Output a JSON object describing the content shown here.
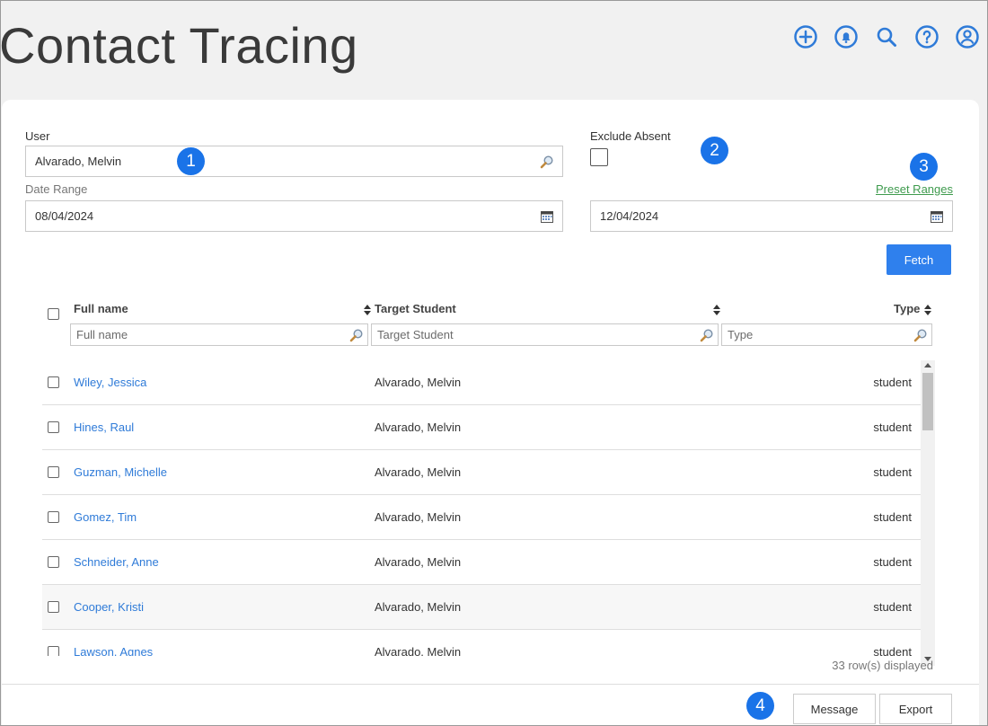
{
  "page": {
    "title": "Contact Tracing"
  },
  "header_icons": [
    "add-circle-icon",
    "bell-icon",
    "search-icon",
    "help-icon",
    "user-account-icon"
  ],
  "colors": {
    "accent": "#2f80ed",
    "badge": "#1a73e8",
    "link": "#2f7bd8",
    "preset_link": "#3f9b4e"
  },
  "form": {
    "user_label": "User",
    "user_value": "Alvarado, Melvin",
    "exclude_absent_label": "Exclude Absent",
    "exclude_absent_checked": false,
    "date_range_label": "Date Range",
    "start_date": "08/04/2024",
    "end_date": "12/04/2024",
    "preset_ranges_label": "Preset Ranges",
    "fetch_label": "Fetch"
  },
  "badges": [
    "1",
    "2",
    "3",
    "4"
  ],
  "grid": {
    "columns": [
      "Full name",
      "Target Student",
      "Type"
    ],
    "filters": {
      "full_name": "Full name",
      "target_student": "Target Student",
      "type": "Type"
    },
    "rows": [
      {
        "full_name": "Wiley, Jessica",
        "target": "Alvarado, Melvin",
        "type": "student"
      },
      {
        "full_name": "Hines, Raul",
        "target": "Alvarado, Melvin",
        "type": "student"
      },
      {
        "full_name": "Guzman, Michelle",
        "target": "Alvarado, Melvin",
        "type": "student"
      },
      {
        "full_name": "Gomez, Tim",
        "target": "Alvarado, Melvin",
        "type": "student"
      },
      {
        "full_name": "Schneider, Anne",
        "target": "Alvarado, Melvin",
        "type": "student"
      },
      {
        "full_name": "Cooper, Kristi",
        "target": "Alvarado, Melvin",
        "type": "student"
      },
      {
        "full_name": "Lawson, Agnes",
        "target": "Alvarado, Melvin",
        "type": "student"
      }
    ],
    "row_count_text": "33 row(s) displayed"
  },
  "footer": {
    "message_label": "Message",
    "export_label": "Export"
  }
}
